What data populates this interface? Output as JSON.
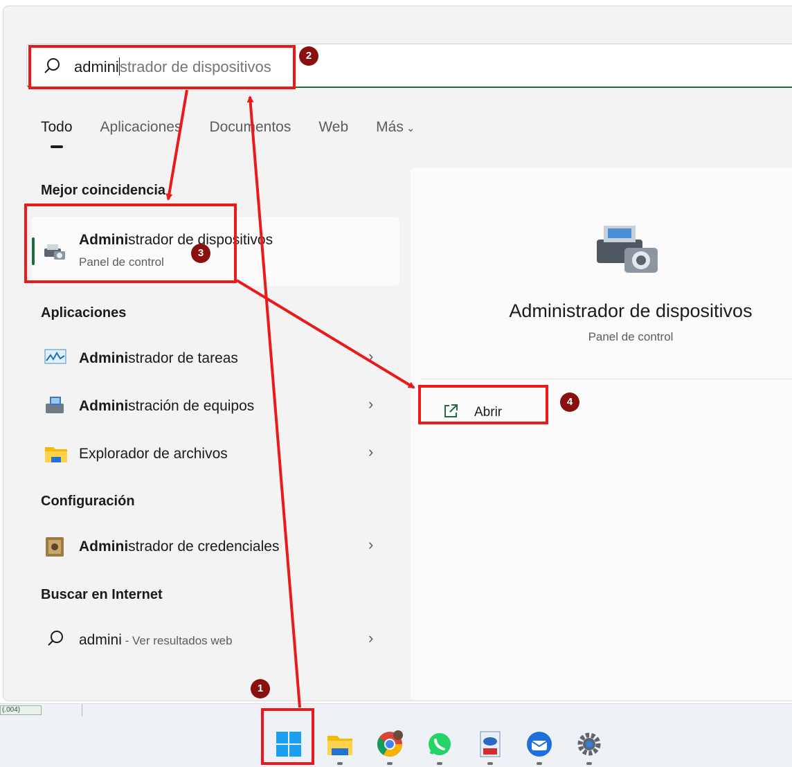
{
  "search": {
    "typed": "admini",
    "completion": "strador de dispositivos"
  },
  "tabs": [
    {
      "label": "Todo"
    },
    {
      "label": "Aplicaciones"
    },
    {
      "label": "Documentos"
    },
    {
      "label": "Web"
    },
    {
      "label": "Más"
    }
  ],
  "sections": {
    "best_match": "Mejor coincidencia",
    "apps": "Aplicaciones",
    "settings": "Configuración",
    "web": "Buscar en Internet"
  },
  "best_match": {
    "title_bold": "Admini",
    "title_rest": "strador de dispositivos",
    "subtitle": "Panel de control"
  },
  "apps": [
    {
      "bold": "Admini",
      "rest": "strador de tareas",
      "icon": "task-manager-icon"
    },
    {
      "bold": "Admini",
      "rest": "stración de equipos",
      "icon": "computer-management-icon"
    },
    {
      "bold": "",
      "rest": "Explorador de archivos",
      "icon": "folder-icon"
    }
  ],
  "settings": [
    {
      "bold": "Admini",
      "rest": "strador de credenciales",
      "icon": "credential-manager-icon"
    }
  ],
  "web": {
    "query": "admini",
    "suffix": " - Ver resultados web"
  },
  "preview": {
    "title": "Administrador de dispositivos",
    "subtitle": "Panel de control",
    "open_label": "Abrir"
  },
  "taskbar": {
    "stub_text": "(.004)",
    "apps": [
      "start-icon",
      "file-explorer-icon",
      "chrome-icon",
      "whatsapp-icon",
      "pdf-viewer-icon",
      "thunderbird-icon",
      "settings-icon"
    ]
  },
  "annotations": {
    "badge_1": "1",
    "badge_2": "2",
    "badge_3": "3",
    "badge_4": "4",
    "color": "#ea1a1a",
    "badge_color": "#8a0f0f"
  },
  "colors": {
    "accent": "#1f6b3f",
    "panel_bg": "#f3f3f3"
  }
}
